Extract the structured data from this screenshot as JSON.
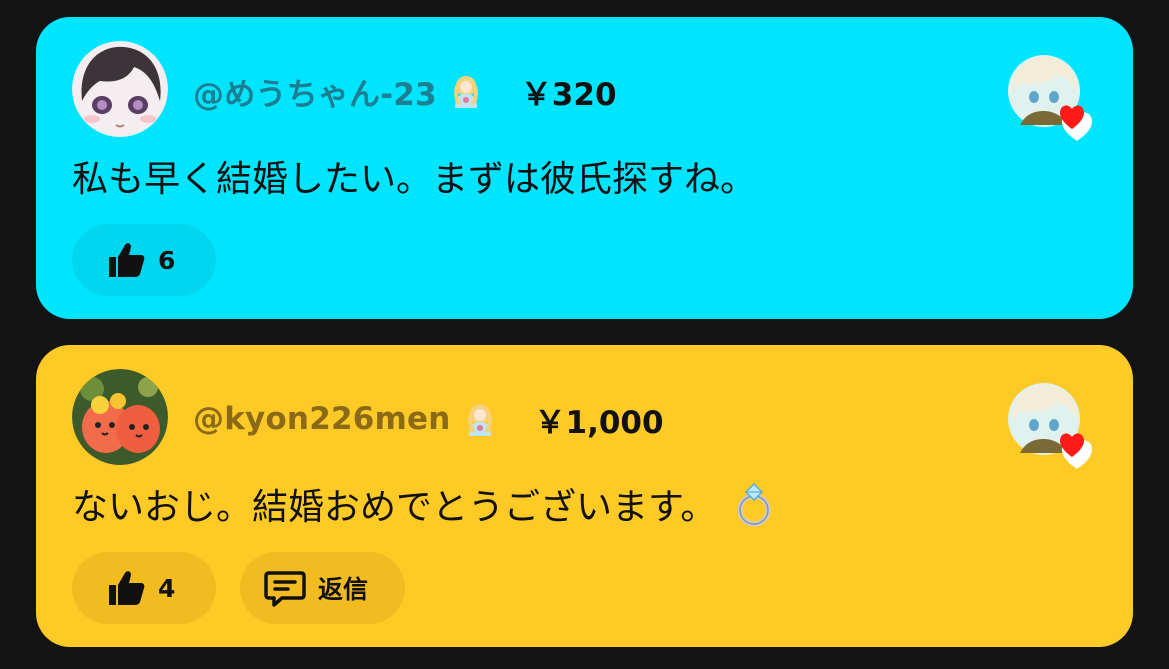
{
  "comments": [
    {
      "username": "@めうちゃん-23",
      "amount": "￥320",
      "message": "私も早く結婚したい。まずは彼氏探すね。",
      "like_count": "6",
      "background_color": "#00e5ff"
    },
    {
      "username": "@kyon226men",
      "amount": "￥1,000",
      "message": "ないおじ。結婚おめでとうございます。",
      "message_emoji": "ring-emoji",
      "like_count": "4",
      "reply_label": "返信",
      "background_color": "#ffc926"
    }
  ],
  "icons": {
    "like": "thumbs-up-icon",
    "reply": "speech-bubble-icon",
    "creator_heart": "heart-icon"
  }
}
